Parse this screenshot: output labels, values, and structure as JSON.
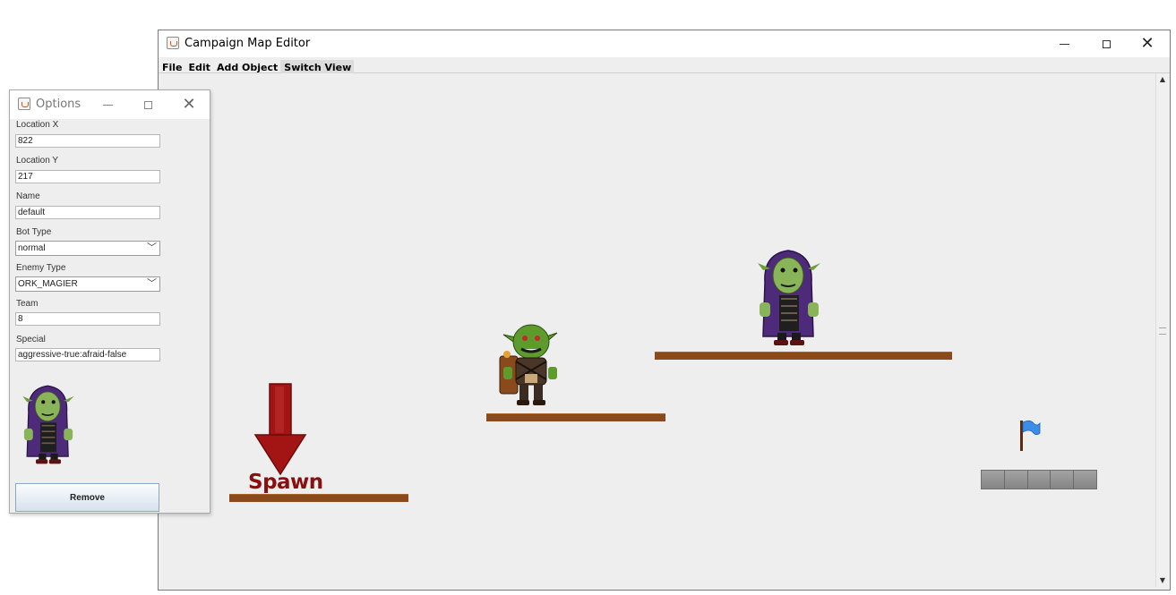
{
  "main_window": {
    "title": "Campaign Map Editor",
    "menu": [
      "File",
      "Edit",
      "Add Object",
      "Switch View"
    ],
    "spawn_label": "Spawn"
  },
  "options_window": {
    "title": "Options",
    "fields": {
      "location_x": {
        "label": "Location X",
        "value": "822"
      },
      "location_y": {
        "label": "Location Y",
        "value": "217"
      },
      "name": {
        "label": "Name",
        "value": "default"
      },
      "bot_type": {
        "label": "Bot Type",
        "value": "normal"
      },
      "enemy_type": {
        "label": "Enemy Type",
        "value": "ORK_MAGIER"
      },
      "team": {
        "label": "Team",
        "value": "8"
      },
      "special": {
        "label": "Special",
        "value": "aggressive-true:afraid-false"
      }
    },
    "remove_label": "Remove"
  },
  "icons": {
    "window": "java-coffee-cup-icon",
    "minimize": "minimize-icon",
    "maximize": "maximize-icon",
    "close": "close-icon",
    "spawn_arrow": "spawn-arrow-icon",
    "flag": "goal-flag-icon"
  },
  "colors": {
    "platform": "#8b4a1b",
    "spawn": "#8a0f0f",
    "flag": "#3a8ee6"
  }
}
